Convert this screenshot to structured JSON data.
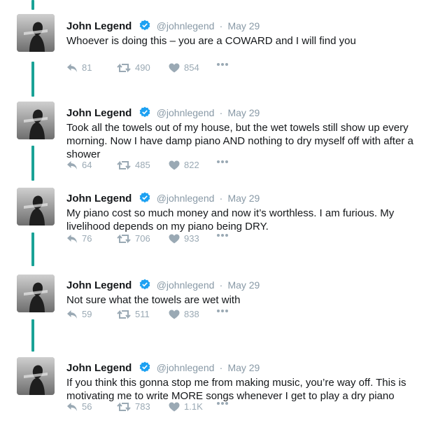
{
  "author": {
    "name": "John Legend",
    "handle": "@johnlegend",
    "separator": "·"
  },
  "tweets": [
    {
      "date": "May 29",
      "text": "Whoever is doing this – you are a COWARD and I will find you",
      "replies": "81",
      "retweets": "490",
      "likes": "854"
    },
    {
      "date": "May 29",
      "text": "Took all the towels out of my house, but the wet towels still show up every morning. Now I have damp piano AND nothing to dry myself off with after a shower",
      "replies": "64",
      "retweets": "485",
      "likes": "822"
    },
    {
      "date": "May 29",
      "text": "My piano cost so much money and now it’s worthless. I am furious. My livelihood depends on my piano being DRY.",
      "replies": "76",
      "retweets": "706",
      "likes": "933"
    },
    {
      "date": "May 29",
      "text": "Not sure what the towels are wet with",
      "replies": "59",
      "retweets": "511",
      "likes": "838"
    },
    {
      "date": "May 29",
      "text": "If you think this gonna stop me from making music, you’re way off. This is motivating me to write MORE songs whenever I get to play a dry piano",
      "replies": "56",
      "retweets": "783",
      "likes": "1.1K"
    }
  ],
  "colors": {
    "thread_line": "#1aa296",
    "verified": "#1da1f2",
    "muted": "#8899a6"
  },
  "icons": [
    "reply-icon",
    "retweet-icon",
    "like-icon",
    "more-icon",
    "verified-icon"
  ]
}
